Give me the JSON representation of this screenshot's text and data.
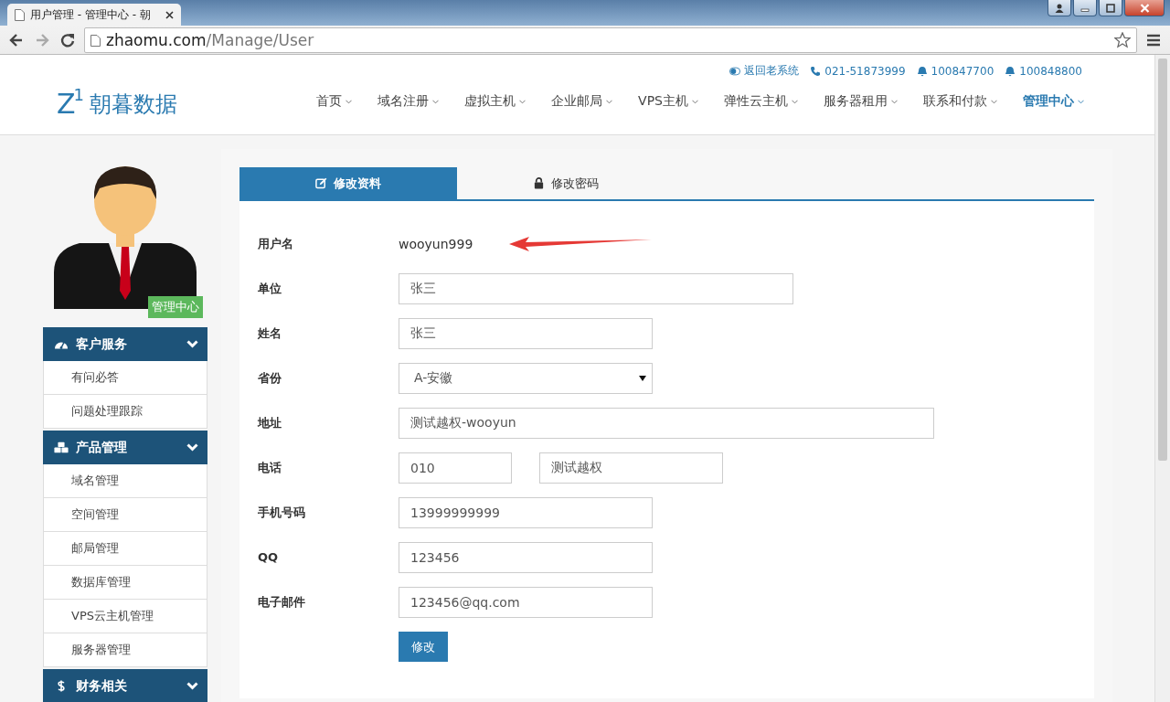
{
  "browser": {
    "tab_title": "用户管理 - 管理中心 - 朝",
    "url_host": "zhaomu.com",
    "url_path": "/Manage/User"
  },
  "header": {
    "top_links": [
      {
        "kind": "toggle",
        "label": "返回老系统"
      },
      {
        "kind": "phone",
        "label": "021-51873999"
      },
      {
        "kind": "qq",
        "label": "100847700"
      },
      {
        "kind": "qq",
        "label": "100848800"
      }
    ],
    "logo": {
      "mark": "Z",
      "mark_sup": "1",
      "name": "朝暮数据"
    },
    "nav": [
      {
        "label": "首页",
        "selected": false
      },
      {
        "label": "域名注册",
        "selected": false
      },
      {
        "label": "虚拟主机",
        "selected": false
      },
      {
        "label": "企业邮局",
        "selected": false
      },
      {
        "label": "VPS主机",
        "selected": false
      },
      {
        "label": "弹性云主机",
        "selected": false
      },
      {
        "label": "服务器租用",
        "selected": false
      },
      {
        "label": "联系和付款",
        "selected": false
      },
      {
        "label": "管理中心",
        "selected": true
      }
    ]
  },
  "sidebar": {
    "badge": "管理中心",
    "sections": [
      {
        "kind": "dashboard",
        "title": "客户服务",
        "items": [
          "有问必答",
          "问题处理跟踪"
        ]
      },
      {
        "kind": "cubes",
        "title": "产品管理",
        "items": [
          "域名管理",
          "空间管理",
          "邮局管理",
          "数据库管理",
          "VPS云主机管理",
          "服务器管理"
        ]
      },
      {
        "kind": "dollar",
        "title": "财务相关"
      }
    ]
  },
  "tabs": [
    {
      "kind": "edit",
      "label": "修改资料",
      "selected": true
    },
    {
      "kind": "lock",
      "label": "修改密码",
      "selected": false
    }
  ],
  "form": {
    "rows": [
      {
        "kind": "text",
        "label": "用户名",
        "value": "wooyun999"
      },
      {
        "kind": "wideinput",
        "label": "单位",
        "value": "张三"
      },
      {
        "kind": "input",
        "label": "姓名",
        "value": "张三"
      },
      {
        "kind": "select",
        "label": "省份",
        "value": "A-安徽"
      },
      {
        "kind": "longinput",
        "label": "地址",
        "value": "测试越权-wooyun"
      },
      {
        "kind": "phone",
        "label": "电话",
        "values": [
          "010",
          "测试越权"
        ]
      },
      {
        "kind": "input",
        "label": "手机号码",
        "value": "13999999999"
      },
      {
        "kind": "input",
        "label": "QQ",
        "value": "123456"
      },
      {
        "kind": "input",
        "label": "电子邮件",
        "value": "123456@qq.com"
      }
    ],
    "submit": "修改"
  }
}
